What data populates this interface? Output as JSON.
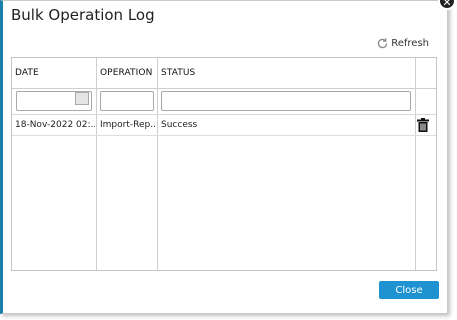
{
  "dialog": {
    "title": "Bulk Operation Log",
    "refresh_label": "Refresh",
    "close_button_label": "Close",
    "close_icon": "close-icon"
  },
  "grid": {
    "columns": [
      "DATE",
      "OPERATION",
      "STATUS"
    ],
    "filters": {
      "date": "",
      "operation": "",
      "status": ""
    },
    "rows": [
      {
        "date": "18-Nov-2022 02:...",
        "operation": "Import-Rep...",
        "status": "Success",
        "action_icon": "trash-icon"
      }
    ]
  },
  "colors": {
    "accent": "#1f93d1",
    "sidebar_edge": "#1a7fa8"
  }
}
